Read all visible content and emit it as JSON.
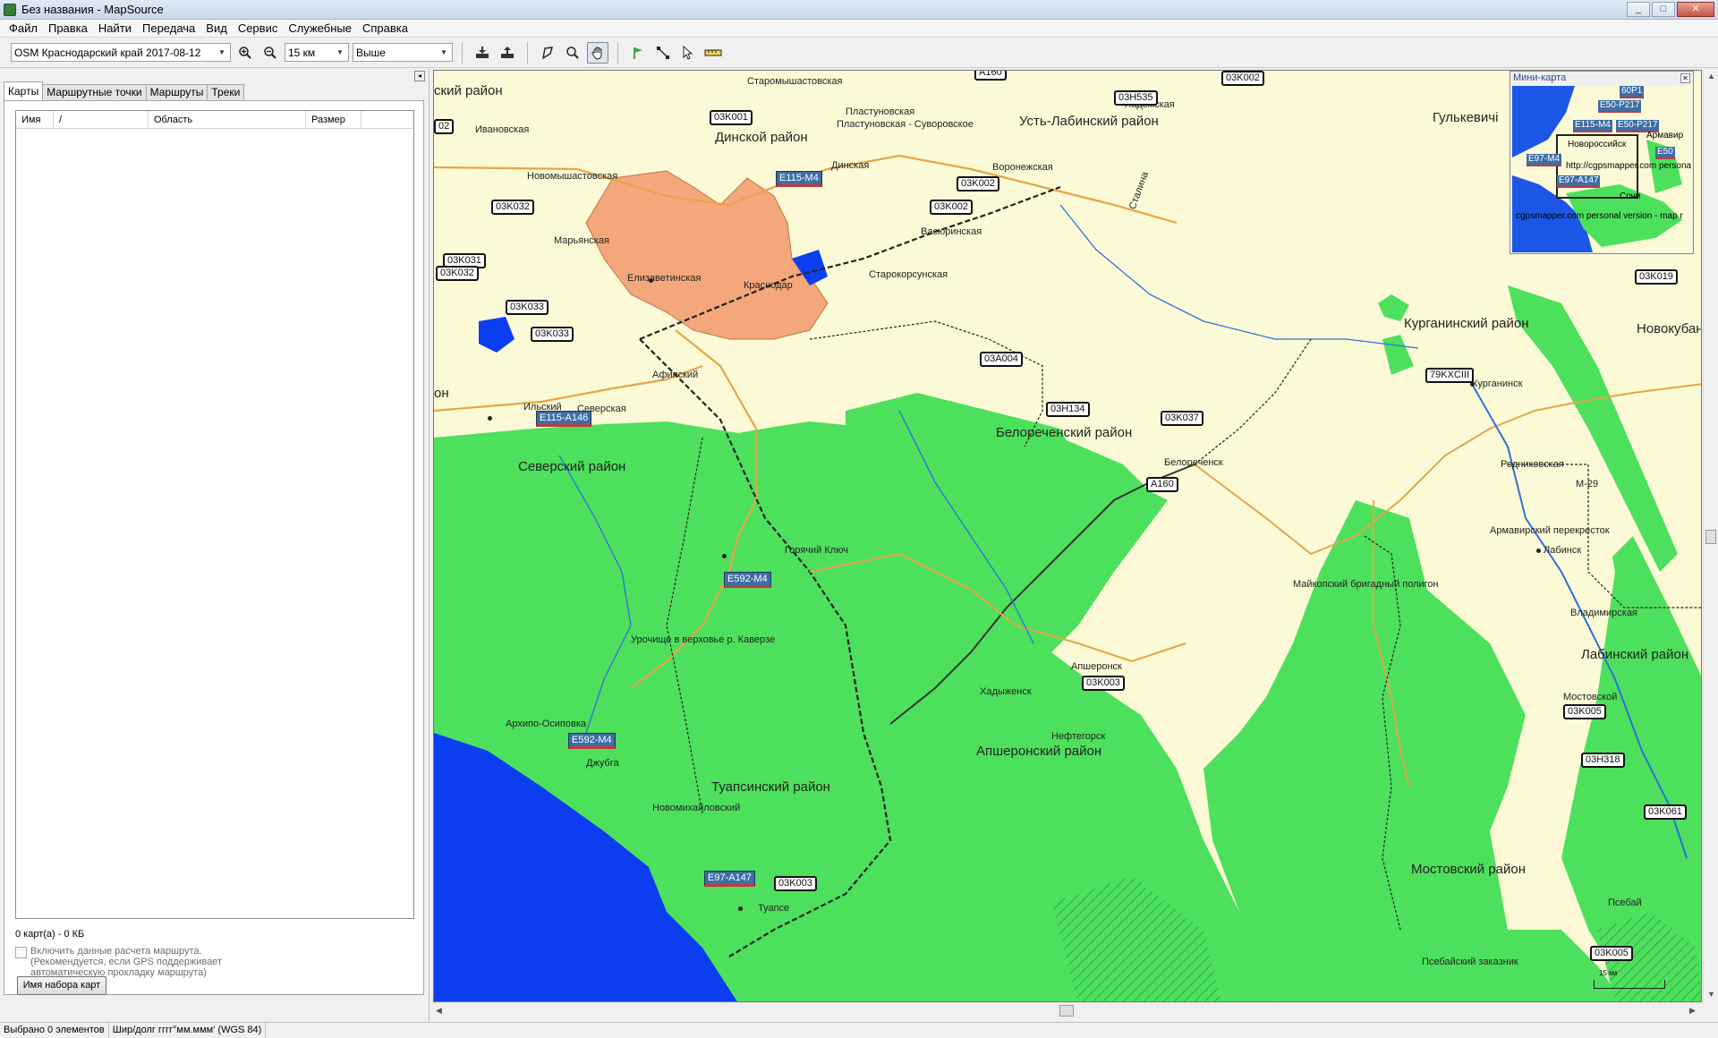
{
  "window": {
    "title": "Без названия - MapSource",
    "minimize": "_",
    "maximize": "□",
    "close": "✕"
  },
  "menu": [
    "Файл",
    "Правка",
    "Найти",
    "Передача",
    "Вид",
    "Сервис",
    "Служебные",
    "Справка"
  ],
  "toolbar": {
    "map_product": "OSM Краснодарский край 2017-08-12",
    "zoom_scale": "15 км",
    "detail_level": "Выше",
    "icons": [
      "zoom-in-icon",
      "zoom-out-icon",
      "receive-from-device-icon",
      "send-to-device-icon",
      "map-tool-icon",
      "zoom-tool-icon",
      "hand-tool-icon",
      "waypoint-tool-icon",
      "route-tool-icon",
      "selection-tool-icon",
      "distance-tool-icon"
    ]
  },
  "left_panel": {
    "collapse": "◂",
    "tabs": [
      "Карты",
      "Маршрутные точки",
      "Маршруты",
      "Треки"
    ],
    "columns": {
      "name": "Имя",
      "sort": "/",
      "region": "Область",
      "size": "Размер"
    },
    "count_text": "0 карт(а) - 0 КБ",
    "routing_checkbox": "Включить данные расчета маршрута.",
    "routing_hint_1": "(Рекомендуется, если GPS поддерживает",
    "routing_hint_2": "автоматическую прокладку маршрута)",
    "mapset_button": "Имя набора карт"
  },
  "map": {
    "districts": {
      "dinskoy": "Динской район",
      "ust_labinsky": "Усть-Лабинский район",
      "gulkevichi": "Гулькевичі",
      "kurganinsky": "Курганинский район",
      "novokuban": "Новокубан",
      "seversky": "Северский район",
      "belorechensky": "Белореченский район",
      "apsheronsky": "Апшеронский район",
      "tuapsinsky": "Туапсинский район",
      "labinsky": "Лабинский район",
      "mostovsky": "Мостовский район",
      "abinsky_left": "ский район",
      "left_edge": "он"
    },
    "places": {
      "staromyshastovskaya": "Старомышастовская",
      "ivanovskaya": "Ивановская",
      "plastunovskaya": "Пластуновская",
      "plastunovskaya_suvorovskoe": "Пластуновская - Суворовское",
      "dinskaya": "Динская",
      "padzhskaya": "Ладожская",
      "novomyshastovskaya": "Новомышастовская",
      "voronezhskaya": "Воронежская",
      "maryanskaya": "Марьянская",
      "vasyurinskaya": "Васюринская",
      "elizavetinskaya": "Елизаветинская",
      "krasnodar": "Краснодар",
      "starokorsunskaya": "Старокорсунская",
      "afipsky": "Афипский",
      "ilsky": "Ильский",
      "severskaya": "Северская",
      "belorechensk": "Белореченск",
      "kurganinsk": "Курганинск",
      "rodnikovskaya": "Родниковская",
      "armavir_perekrestok": "Армавирский перекресток",
      "labinsk": "Лабинск",
      "goryachy_klyuch": "Горячий Ключ",
      "maikop_poligon": "Майкопский бригадный полигон",
      "urochishe": "Урочище в верховье р. Каверзе",
      "vladimirskaya": "Владимирская",
      "apsheronsk": "Апшеронск",
      "khadyzhensk": "Хадыженск",
      "mostovskoy": "Мостовской",
      "neftegorsk": "Нефтегорск",
      "arkhipo_osipovka": "Архипо-Осиповка",
      "dzhubga": "Джубга",
      "novomikhailovsky": "Новомихайловский",
      "tuapse": "Туапсе",
      "psebay": "Псебай",
      "psebaysky_zakaznik": "Псебайский заказник",
      "stalina": "Сталина",
      "m29": "M-29"
    },
    "shields": {
      "e115_m4": "E115-M4",
      "e115_a146": "E115-A146",
      "e592_m4_a": "E592-M4",
      "e592_m4_b": "E592-M4",
      "e97_a147": "E97-A147",
      "a160": "A160"
    },
    "regional": {
      "k001": "03K001",
      "k002_a": "03K002",
      "k002_b": "03K002",
      "k002_c": "03K002",
      "h535": "03H535",
      "k032": "03K032",
      "k031": "03K031",
      "k032_b": "03K032",
      "k033": "03K033",
      "k033_b": "03K033",
      "a004": "03A004",
      "h134": "03H134",
      "k037": "03K037",
      "kxciii": "79KXCIII",
      "k019": "03K019",
      "k003_a": "03K003",
      "k003_b": "03K003",
      "k005_a": "03K005",
      "k005_b": "03K005",
      "h318": "03H318",
      "k061": "03K061",
      "a160_top": "A160",
      "num02": "02"
    },
    "scale": "15 км"
  },
  "minimap": {
    "title": "Мини-карта",
    "close": "✕",
    "shields": {
      "s1": "E50-P217",
      "s2": "E115-M4",
      "s3": "E50-P217",
      "s4": "E50",
      "s5": "E97-M4",
      "s6": "E97-A147",
      "s7": "60P1"
    },
    "texts": {
      "armavir": "Армавир",
      "novoross": "Новороссийск",
      "url": "http://cgpsmapper.com personal",
      "sochi": "Сочи",
      "footer": "cgpsmapper.com personal version - map r"
    }
  },
  "status": {
    "selection": "Выбрано 0 элементов",
    "coords": "Шир/долг гггг°мм.ммм' (WGS 84)"
  },
  "colors": {
    "forest": "#4de05c",
    "sea": "#0a3ef0",
    "urban": "#f4a77a",
    "background": "#fcfad6"
  }
}
